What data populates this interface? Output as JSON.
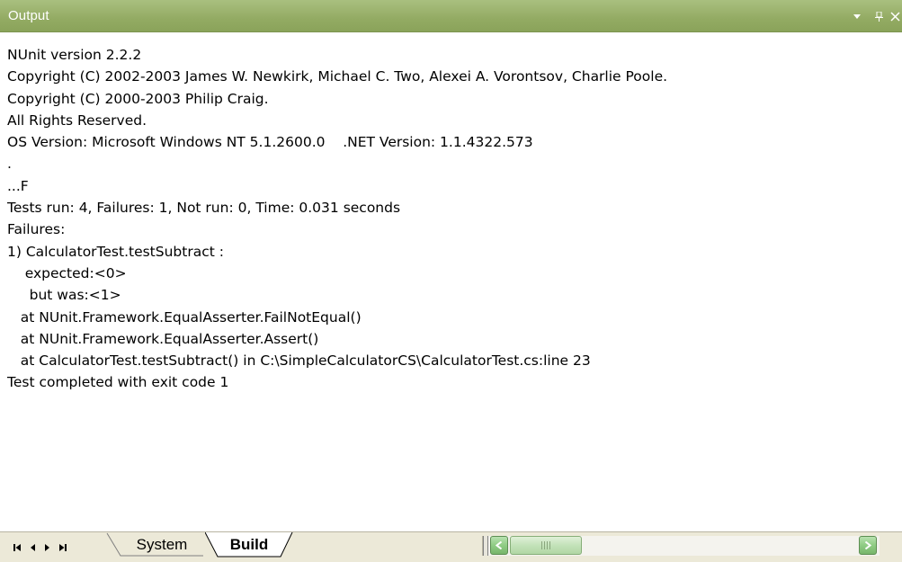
{
  "window": {
    "title": "Output",
    "controls": {
      "dropdown_icon": "chevron-down-icon",
      "pin_icon": "pin-icon",
      "close_icon": "close-icon"
    }
  },
  "output": {
    "lines": [
      "NUnit version 2.2.2",
      "Copyright (C) 2002-2003 James W. Newkirk, Michael C. Two, Alexei A. Vorontsov, Charlie Poole.",
      "Copyright (C) 2000-2003 Philip Craig.",
      "All Rights Reserved.",
      "OS Version: Microsoft Windows NT 5.1.2600.0    .NET Version: 1.1.4322.573",
      ".",
      "...F",
      "Tests run: 4, Failures: 1, Not run: 0, Time: 0.031 seconds",
      "Failures:",
      "1) CalculatorTest.testSubtract :",
      "    expected:<0>",
      "     but was:<1>",
      "   at NUnit.Framework.EqualAsserter.FailNotEqual()",
      "   at NUnit.Framework.EqualAsserter.Assert()",
      "   at CalculatorTest.testSubtract() in C:\\SimpleCalculatorCS\\CalculatorTest.cs:line 23",
      "Test completed with exit code 1"
    ]
  },
  "bottom_bar": {
    "nav_icons": [
      "first-tab-icon",
      "prev-tab-icon",
      "next-tab-icon",
      "last-tab-icon"
    ],
    "tabs": [
      {
        "label": "System",
        "active": false
      },
      {
        "label": "Build",
        "active": true
      }
    ],
    "scroll_grip": "|||"
  },
  "colors": {
    "titlebar": "#93ab63",
    "titlebar_text": "#ffffff",
    "scroll_accent": "#8fcc84",
    "tab_strip": "#ece9d8"
  }
}
